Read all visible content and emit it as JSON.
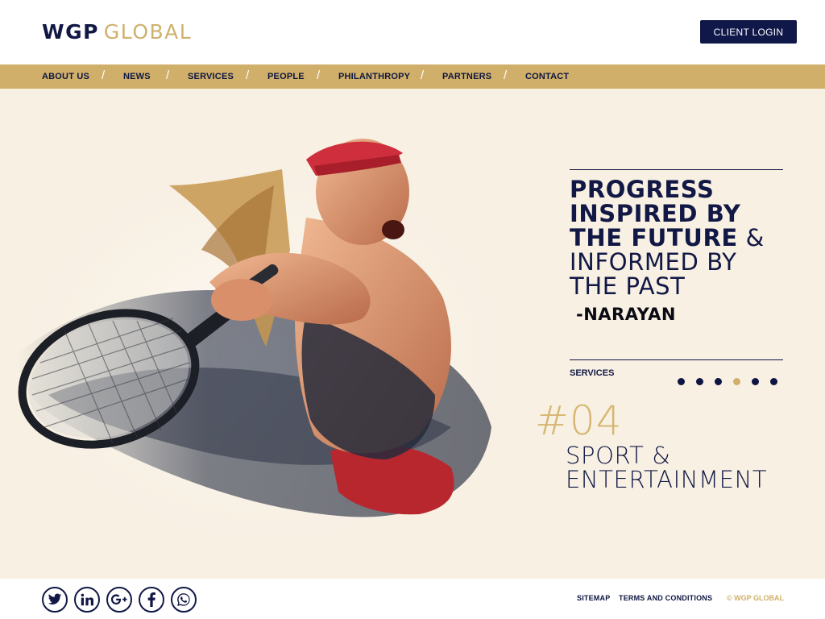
{
  "header": {
    "logo_primary": "WGP",
    "logo_secondary": "GLOBAL",
    "login_label": "CLIENT LOGIN"
  },
  "nav": {
    "items": [
      "ABOUT US",
      "NEWS",
      "SERVICES",
      "PEOPLE",
      "PHILANTHROPY",
      "PARTNERS",
      "CONTACT"
    ],
    "separator": "/"
  },
  "hero": {
    "quote_line1": "PROGRESS",
    "quote_line2": "INSPIRED BY",
    "quote_line3_bold": "THE FUTURE",
    "quote_amp": " &",
    "quote_line4": "INFORMED BY",
    "quote_line5": "THE PAST",
    "author": "-NARAYAN",
    "section_label": "SERVICES",
    "slide_count": 6,
    "active_slide": 4,
    "slide_number": "#04",
    "slide_title_line1": "SPORT &",
    "slide_title_line2": "ENTERTAINMENT"
  },
  "footer": {
    "social": [
      "twitter-icon",
      "linkedin-icon",
      "google-plus-icon",
      "facebook-icon",
      "whatsapp-icon"
    ],
    "links": [
      "SITEMAP",
      "TERMS AND CONDITIONS"
    ],
    "copyright": "© WGP GLOBAL"
  },
  "colors": {
    "navy": "#0f1848",
    "gold": "#cfaf69",
    "hero_bg": "#f8f0e3"
  }
}
